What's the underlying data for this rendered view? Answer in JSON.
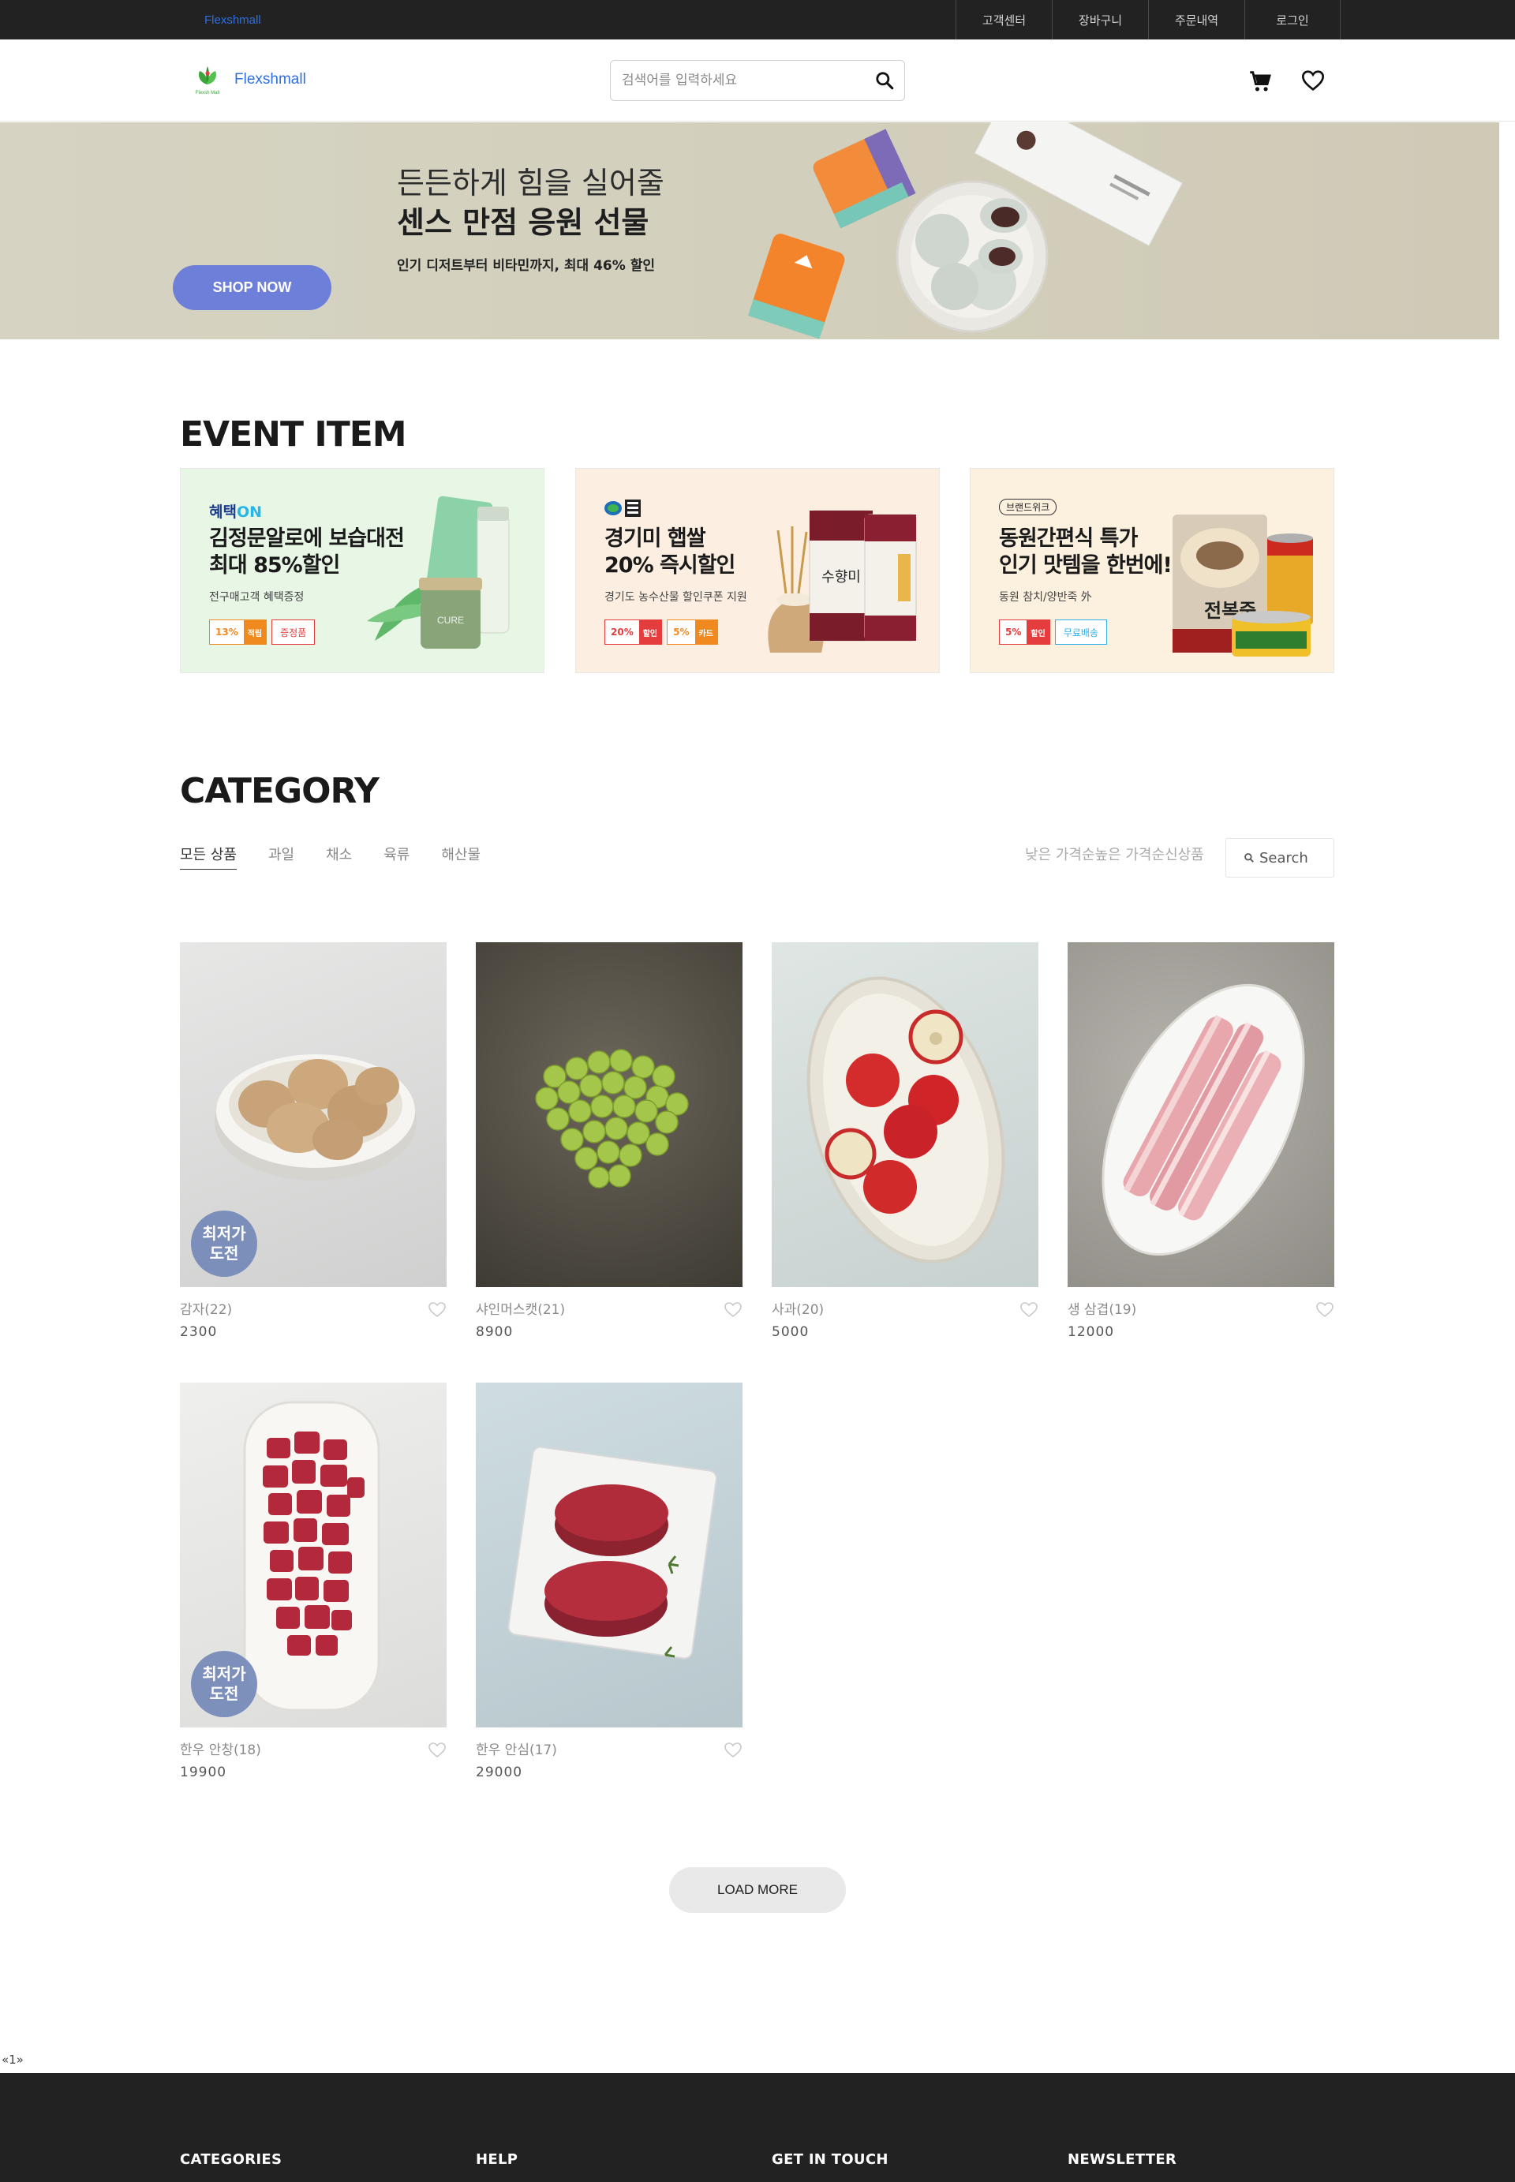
{
  "topbar": {
    "brand": "Flexshmall",
    "links": [
      "고객센터",
      "장바구니",
      "주문내역",
      "로그인"
    ]
  },
  "header": {
    "logo_text": "Flexshmall",
    "logo_mark_text": "Flexsh Mall",
    "search_placeholder": "검색어를 입력하세요",
    "icons": [
      "search-icon",
      "cart-icon",
      "heart-icon"
    ]
  },
  "hero": {
    "line1": "든든하게 힘을 실어줄",
    "line2": "센스 만점 응원 선물",
    "line3": "인기 디저트부터 비타민까지, 최대 46% 할인",
    "button": "SHOP NOW",
    "bg_color": "#d4d1bf",
    "button_color": "#6e7fd9"
  },
  "event": {
    "title": "EVENT ITEM",
    "cards": [
      {
        "tag": "혜택",
        "tag_accent": "ON",
        "line1": "김정문알로에 보습대전",
        "line2": "최대 85%할인",
        "sub": "전구매고객 혜택증정",
        "badges": [
          {
            "num": "13%",
            "label": "적립"
          },
          {
            "text": "증정품"
          }
        ],
        "bg": "#e8f6e6"
      },
      {
        "line1": "경기미 햅쌀",
        "line2": "20% 즉시할인",
        "sub": "경기도 농수산물 할인쿠폰 지원",
        "badges": [
          {
            "num": "20%",
            "label": "할인"
          },
          {
            "num": "5%",
            "label": "카드"
          }
        ],
        "bg": "#fcefe1"
      },
      {
        "tag": "브랜드위크",
        "line1": "동원간편식 특가",
        "line2": "인기 맛템을 한번에!",
        "sub": "동원 참치/양반죽 外",
        "badges": [
          {
            "num": "5%",
            "label": "할인"
          },
          {
            "text": "무료배송"
          }
        ],
        "bg": "#fcf0de"
      }
    ]
  },
  "category": {
    "title": "CATEGORY",
    "tabs": [
      "모든 상품",
      "과일",
      "채소",
      "육류",
      "해산물"
    ],
    "active_tab": "모든 상품",
    "sort": [
      "낮은 가격순",
      "높은 가격순",
      "신상품"
    ],
    "search_label": "Search"
  },
  "products": [
    {
      "name": "감자(22)",
      "price": "2300",
      "badge": [
        "최저가",
        "도전"
      ],
      "image": "potatoes"
    },
    {
      "name": "샤인머스캣(21)",
      "price": "8900",
      "image": "green-grapes"
    },
    {
      "name": "사과(20)",
      "price": "5000",
      "image": "apples"
    },
    {
      "name": "생 삼겹(19)",
      "price": "12000",
      "image": "pork-belly"
    },
    {
      "name": "한우 안창(18)",
      "price": "19900",
      "badge": [
        "최저가",
        "도전"
      ],
      "image": "beef-cubes"
    },
    {
      "name": "한우 안심(17)",
      "price": "29000",
      "image": "beef-tenderloin"
    }
  ],
  "load_more": "LOAD MORE",
  "pager": "«1»",
  "footer": {
    "columns": [
      "CATEGORIES",
      "HELP",
      "GET IN TOUCH",
      "NEWSLETTER"
    ]
  }
}
